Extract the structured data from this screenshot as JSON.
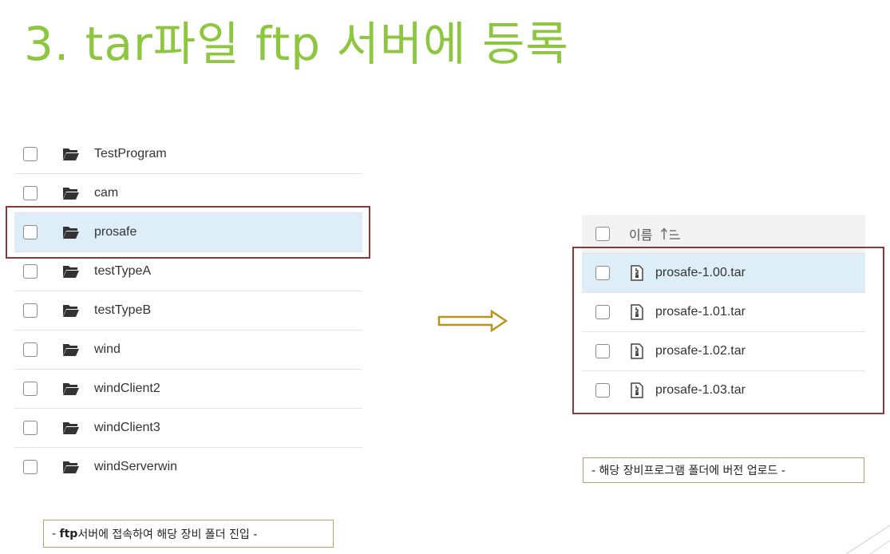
{
  "title": "3. tar파일 ftp 서버에 등록",
  "left_panel": {
    "items": [
      {
        "label": "TestProgram",
        "selected": false
      },
      {
        "label": "cam",
        "selected": false
      },
      {
        "label": "prosafe",
        "selected": true
      },
      {
        "label": "testTypeA",
        "selected": false
      },
      {
        "label": "testTypeB",
        "selected": false
      },
      {
        "label": "wind",
        "selected": false
      },
      {
        "label": "windClient2",
        "selected": false
      },
      {
        "label": "windClient3",
        "selected": false
      },
      {
        "label": "windServerwin",
        "selected": false
      }
    ],
    "caption_prefix": "- ",
    "caption_bold": "ftp",
    "caption_rest": "서버에 접속하여 해당 장비 폴더 진입 -"
  },
  "right_panel": {
    "header_label": "이름",
    "sort_icon": "sort-ascending-icon",
    "files": [
      {
        "label": "prosafe-1.00.tar",
        "selected": true
      },
      {
        "label": "prosafe-1.01.tar",
        "selected": false
      },
      {
        "label": "prosafe-1.02.tar",
        "selected": false
      },
      {
        "label": "prosafe-1.03.tar",
        "selected": false
      }
    ],
    "caption": "- 해당 장비프로그램 폴더에 버전 업로드 -"
  },
  "colors": {
    "title": "#8dc63f",
    "selected_row": "#ddeef8",
    "highlight_border": "#8b3a3a",
    "arrow": "#b8941f",
    "caption_border": "#b8a16a"
  }
}
